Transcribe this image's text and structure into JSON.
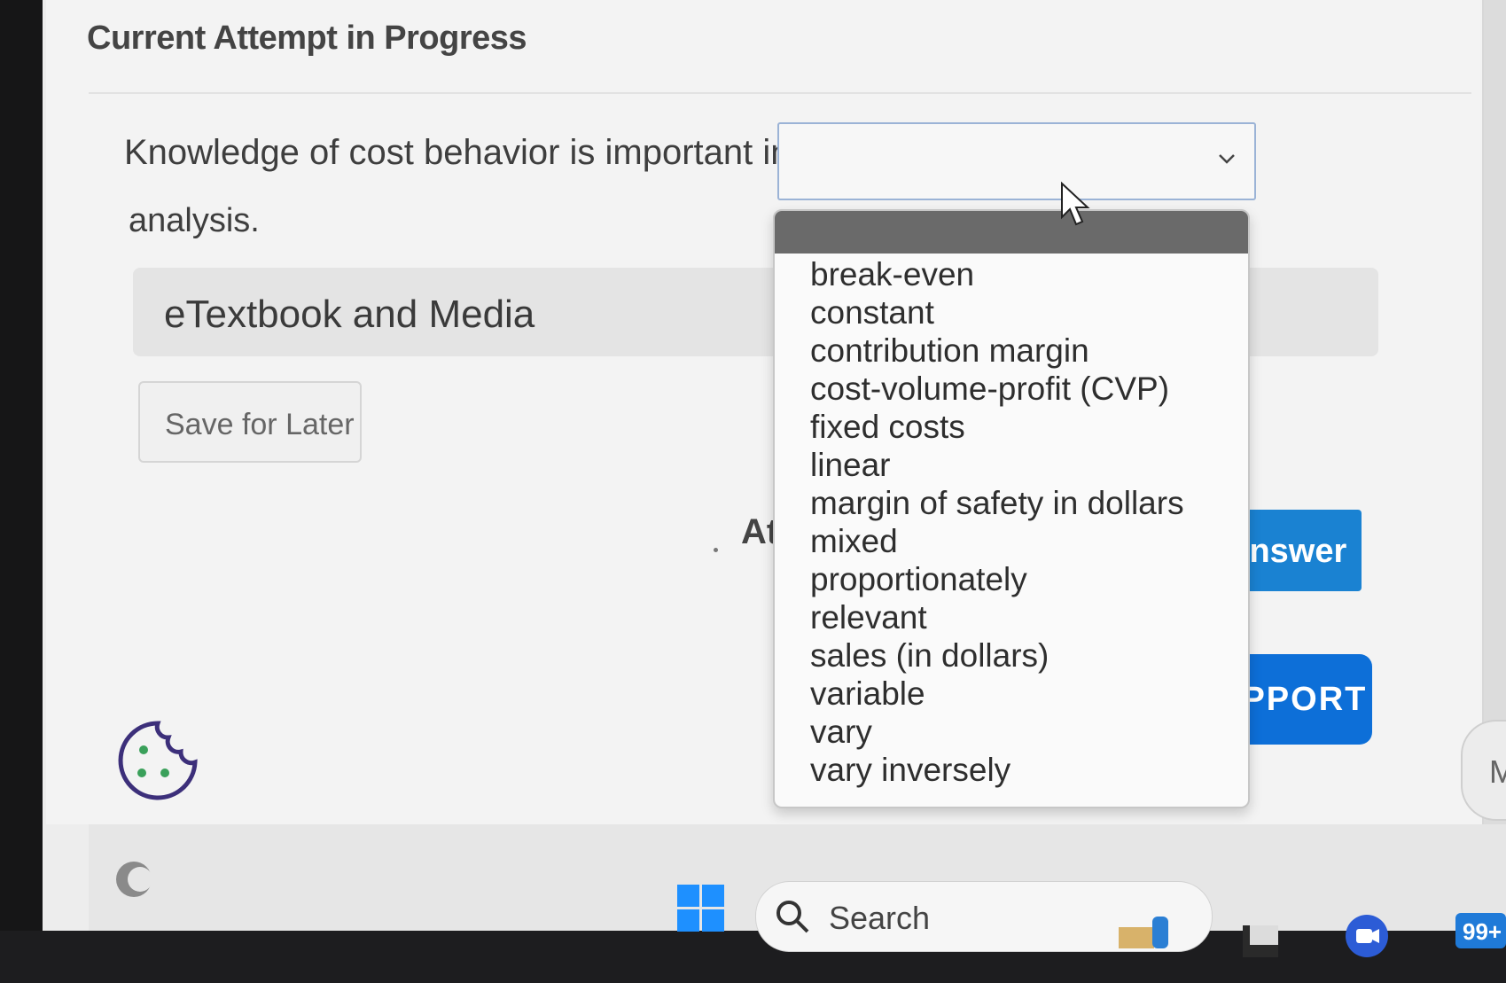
{
  "header": {
    "title": "Current Attempt in Progress"
  },
  "question": {
    "text_before": "Knowledge of cost behavior is important in",
    "text_after": "analysis.",
    "select_value": ""
  },
  "etextbook": {
    "label": "eTextbook and Media"
  },
  "save_button": {
    "label": "Save for Later"
  },
  "attempts_fragment": "At",
  "submit_button": {
    "label": "Answer"
  },
  "support_button": {
    "label": "UPPORT"
  },
  "side_button": {
    "label": "M"
  },
  "dropdown": {
    "options": [
      "break-even",
      "constant",
      "contribution margin",
      "cost-volume-profit (CVP)",
      "fixed costs",
      "linear",
      "margin of safety in dollars",
      "mixed",
      "proportionately",
      "relevant",
      "sales (in dollars)",
      "variable",
      "vary",
      "vary inversely"
    ]
  },
  "taskbar": {
    "search_placeholder": "Search",
    "notification_badge": "99+"
  },
  "colors": {
    "accent_blue": "#1a82d2",
    "support_blue": "#0d6fd8",
    "windows_blue": "#1e90ff"
  }
}
